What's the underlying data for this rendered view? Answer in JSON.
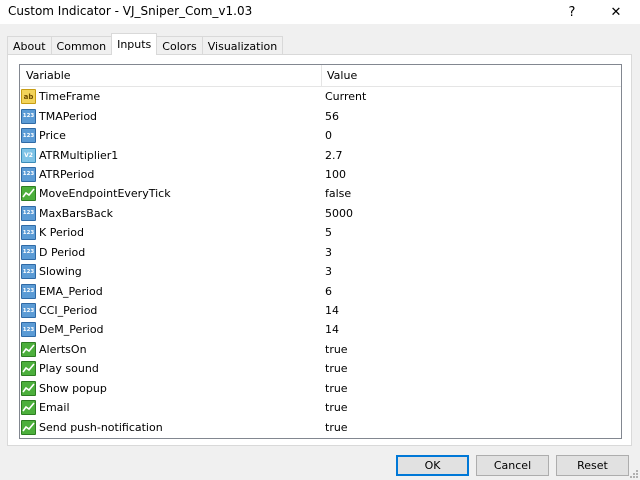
{
  "window": {
    "title": "Custom Indicator - VJ_Sniper_Com_v1.03",
    "help_label": "?",
    "close_label": "✕"
  },
  "tabs": [
    {
      "label": "About"
    },
    {
      "label": "Common"
    },
    {
      "label": "Inputs"
    },
    {
      "label": "Colors"
    },
    {
      "label": "Visualization"
    }
  ],
  "active_tab": "Inputs",
  "grid": {
    "headers": {
      "variable": "Variable",
      "value": "Value"
    },
    "rows": [
      {
        "icon": "ab",
        "name": "TimeFrame",
        "value": "Current"
      },
      {
        "icon": "123",
        "name": "TMAPeriod",
        "value": "56"
      },
      {
        "icon": "123",
        "name": "Price",
        "value": "0"
      },
      {
        "icon": "V2",
        "name": "ATRMultiplier1",
        "value": "2.7"
      },
      {
        "icon": "123",
        "name": "ATRPeriod",
        "value": "100"
      },
      {
        "icon": "bool",
        "name": "MoveEndpointEveryTick",
        "value": "false"
      },
      {
        "icon": "123",
        "name": "MaxBarsBack",
        "value": "5000"
      },
      {
        "icon": "123",
        "name": "K Period",
        "value": "5"
      },
      {
        "icon": "123",
        "name": "D Period",
        "value": "3"
      },
      {
        "icon": "123",
        "name": "Slowing",
        "value": "3"
      },
      {
        "icon": "123",
        "name": "EMA_Period",
        "value": "6"
      },
      {
        "icon": "123",
        "name": "CCI_Period",
        "value": "14"
      },
      {
        "icon": "123",
        "name": "DeM_Period",
        "value": "14"
      },
      {
        "icon": "bool",
        "name": "AlertsOn",
        "value": "true"
      },
      {
        "icon": "bool",
        "name": "Play sound",
        "value": "true"
      },
      {
        "icon": "bool",
        "name": "Show popup",
        "value": "true"
      },
      {
        "icon": "bool",
        "name": "Email",
        "value": "true"
      },
      {
        "icon": "bool",
        "name": "Send push-notification",
        "value": "true"
      }
    ]
  },
  "buttons": {
    "ok": "OK",
    "cancel": "Cancel",
    "reset": "Reset"
  },
  "colors": {
    "ok_border": "#0078d7",
    "bool_icon": "#4caf3c",
    "int_icon": "#5b9bd5",
    "string_icon": "#f2d35a"
  }
}
